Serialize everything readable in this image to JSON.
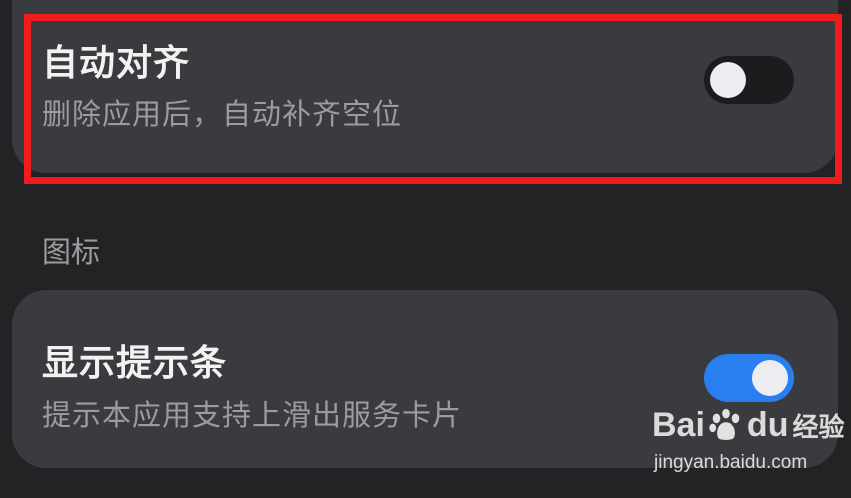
{
  "settings": {
    "auto_align": {
      "title": "自动对齐",
      "description": "删除应用后，自动补齐空位",
      "enabled": false
    },
    "icons_section": {
      "label": "图标"
    },
    "show_hint_bar": {
      "title": "显示提示条",
      "description": "提示本应用支持上滑出服务卡片",
      "enabled": true
    }
  },
  "watermark": {
    "brand_prefix": "Bai",
    "brand_suffix": "du",
    "brand_cn": "经验",
    "url": "jingyan.baidu.com"
  },
  "colors": {
    "background": "#222325",
    "card": "#3a3b3e",
    "toggle_on": "#2a7ff0",
    "toggle_off": "#1c1c1e",
    "highlight": "#f01b1b"
  }
}
